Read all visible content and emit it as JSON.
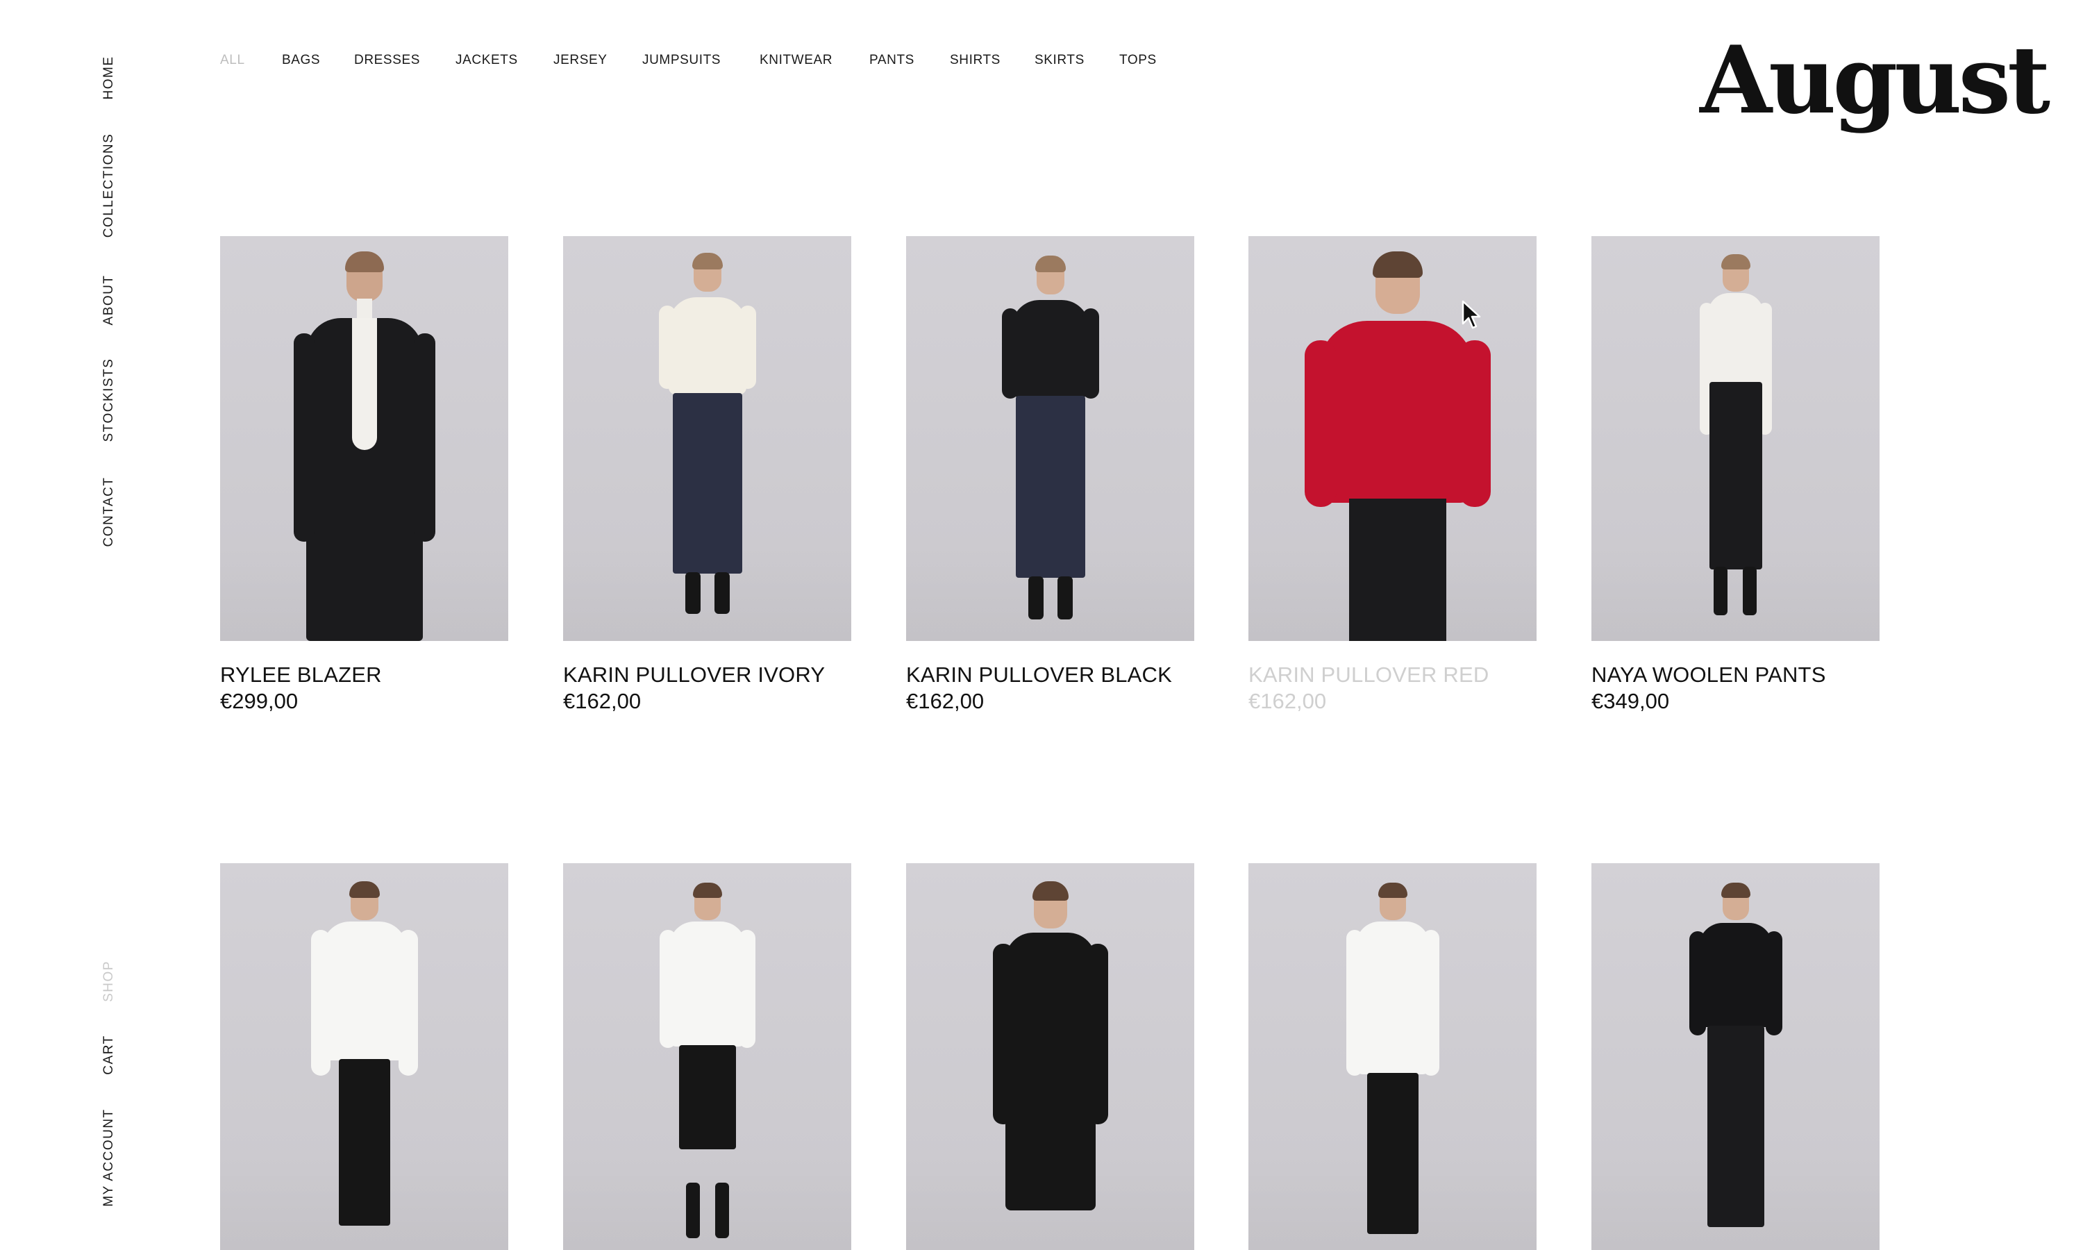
{
  "side_nav": {
    "top_items": [
      "HOME",
      "COLLECTIONS",
      "ABOUT",
      "STOCKISTS",
      "CONTACT"
    ],
    "shop": "SHOP",
    "cart": "CART",
    "account": "MY ACCOUNT"
  },
  "filters": [
    "ALL",
    "BAGS",
    "DRESSES",
    "JACKETS",
    "JERSEY",
    "JUMPSUITS",
    "KNITWEAR",
    "PANTS",
    "SHIRTS",
    "SKIRTS",
    "TOPS"
  ],
  "brand": {
    "logo_text": "August"
  },
  "products_row1": [
    {
      "name": "RYLEE BLAZER",
      "price": "€299,00"
    },
    {
      "name": "KARIN PULLOVER IVORY",
      "price": "€162,00"
    },
    {
      "name": "KARIN PULLOVER BLACK",
      "price": "€162,00"
    },
    {
      "name": "KARIN PULLOVER RED",
      "price": "€162,00"
    },
    {
      "name": "NAYA WOOLEN PANTS",
      "price": "€349,00"
    }
  ],
  "colors": {
    "text": "#111111",
    "muted": "#c9c9c9",
    "photo_bg": "#d0ced3",
    "red_pullover": "#c4122e",
    "ivory": "#f2eee4",
    "black_garment": "#1b1b1d",
    "denim": "#2c3044"
  }
}
